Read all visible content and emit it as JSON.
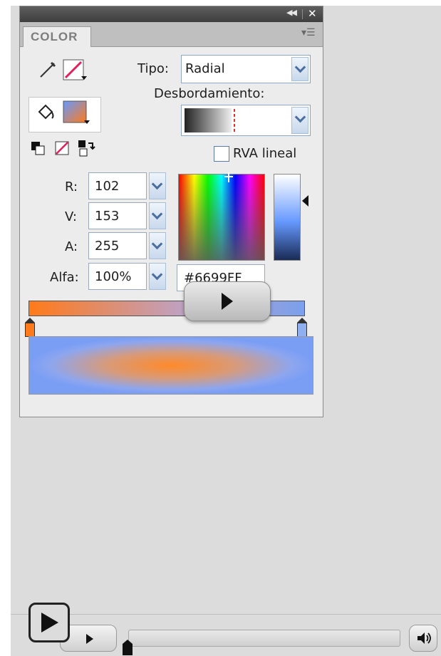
{
  "panel": {
    "tab_title": "COLOR",
    "tipo_label": "Tipo:",
    "tipo_value": "Radial",
    "desbordamiento_label": "Desbordamiento:",
    "rva_label": "RVA lineal",
    "rva_checked": false,
    "channels": [
      {
        "label": "R:",
        "value": "102"
      },
      {
        "label": "V:",
        "value": "153"
      },
      {
        "label": "A:",
        "value": "255"
      },
      {
        "label": "Alfa:",
        "value": "100%"
      }
    ],
    "hex_value": "#6699FF",
    "gradient_stops": [
      "#ff7a1a",
      "#7aa0ee"
    ]
  },
  "colors": {
    "stroke_none": "#e0205a",
    "fill": "#6699ff",
    "accent_orange": "#ff7a1a"
  },
  "player": {
    "play_icon": "play-icon",
    "volume_icon": "speaker-icon"
  }
}
